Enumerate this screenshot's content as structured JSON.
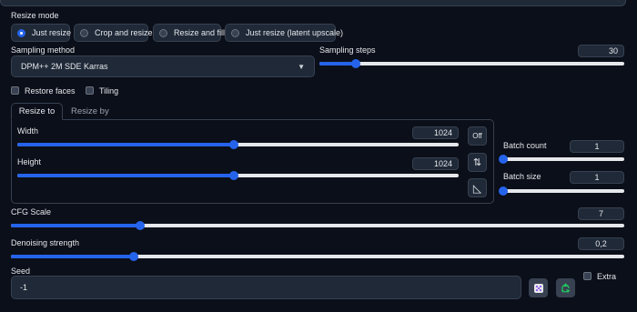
{
  "resize_mode": {
    "label": "Resize mode",
    "options": [
      "Just resize",
      "Crop and resize",
      "Resize and fill",
      "Just resize (latent upscale)"
    ],
    "selected": "Just resize"
  },
  "sampling_method": {
    "label": "Sampling method",
    "value": "DPM++ 2M SDE Karras"
  },
  "sampling_steps": {
    "label": "Sampling steps",
    "value": "30",
    "fraction": 0.12
  },
  "restore_faces": {
    "label": "Restore faces",
    "checked": false
  },
  "tiling": {
    "label": "Tiling",
    "checked": false
  },
  "tabs": {
    "active": "Resize to",
    "inactive": "Resize by"
  },
  "width": {
    "label": "Width",
    "value": "1024",
    "fraction": 0.49
  },
  "height": {
    "label": "Height",
    "value": "1024",
    "fraction": 0.49
  },
  "tool_buttons": {
    "off_label": "Off",
    "swap_symbol": "⇅",
    "ratio_symbol": "◺"
  },
  "batch_count": {
    "label": "Batch count",
    "value": "1",
    "fraction": 0.0
  },
  "batch_size": {
    "label": "Batch size",
    "value": "1",
    "fraction": 0.0
  },
  "cfg_scale": {
    "label": "CFG Scale",
    "value": "7",
    "fraction": 0.21
  },
  "denoising_strength": {
    "label": "Denoising strength",
    "value": "0,2",
    "fraction": 0.2
  },
  "seed": {
    "label": "Seed",
    "value": "-1",
    "extra_label": "Extra"
  },
  "icons": {
    "dice": "dice-icon",
    "recycle": "recycle-icon"
  },
  "colors": {
    "accent": "#2563eb",
    "background": "#0b0f19",
    "panel": "#1f2937",
    "border": "#374151",
    "recycle_green": "#22c55e"
  }
}
